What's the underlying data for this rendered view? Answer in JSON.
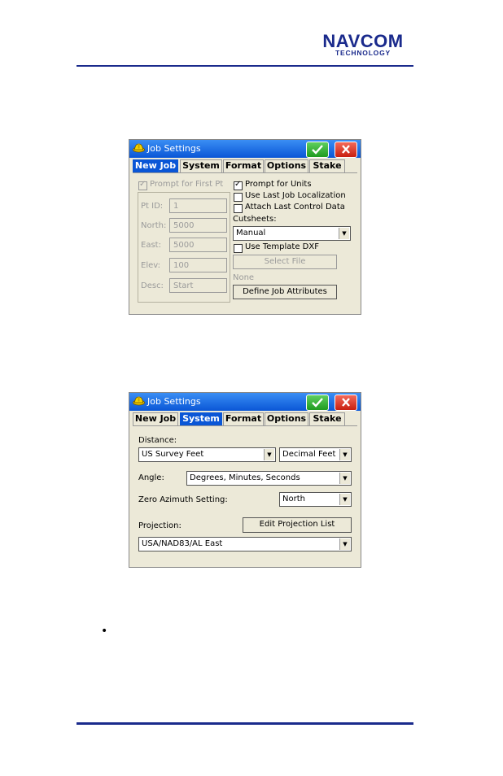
{
  "header": {
    "logo_main": "NAVCOM",
    "logo_sub": "TECHNOLOGY"
  },
  "colors": {
    "brand": "#1a2a8c",
    "titlebar": "#0a56d6",
    "active_tab": "#0a56d6",
    "ok_button": "#2aa82a",
    "close_button": "#d9301f",
    "dialog_bg": "#ece9d8"
  },
  "dialog1": {
    "title": "Job Settings",
    "icons": {
      "app": "hardhat-icon",
      "ok": "checkmark-icon",
      "close": "close-x-icon"
    },
    "tabs": [
      "New Job",
      "System",
      "Format",
      "Options",
      "Stake"
    ],
    "active_tab": "New Job",
    "prompt_first_pt": "Prompt for First Pt",
    "fields": [
      {
        "label": "Pt ID:",
        "value": "1"
      },
      {
        "label": "North:",
        "value": "5000"
      },
      {
        "label": "East:",
        "value": "5000"
      },
      {
        "label": "Elev:",
        "value": "100"
      },
      {
        "label": "Desc:",
        "value": "Start"
      }
    ],
    "prompt_units": "Prompt for Units",
    "use_last_job": "Use Last Job Localization",
    "attach_control": "Attach Last Control Data",
    "cutsheets_label": "Cutsheets:",
    "cutsheets_value": "Manual",
    "use_template": "Use Template DXF",
    "select_file": "Select File",
    "none_text": "None",
    "define_attrs": "Define Job Attributes"
  },
  "dialog2": {
    "title": "Job Settings",
    "tabs": [
      "New Job",
      "System",
      "Format",
      "Options",
      "Stake"
    ],
    "active_tab": "System",
    "distance_label": "Distance:",
    "distance_units": "US Survey Feet",
    "distance_format": "Decimal Feet",
    "angle_label": "Angle:",
    "angle_value": "Degrees, Minutes, Seconds",
    "zero_az_label": "Zero Azimuth Setting:",
    "zero_az_value": "North",
    "projection_label": "Projection:",
    "edit_projection": "Edit Projection List",
    "projection_value": "USA/NAD83/AL East"
  },
  "bullet": "•"
}
